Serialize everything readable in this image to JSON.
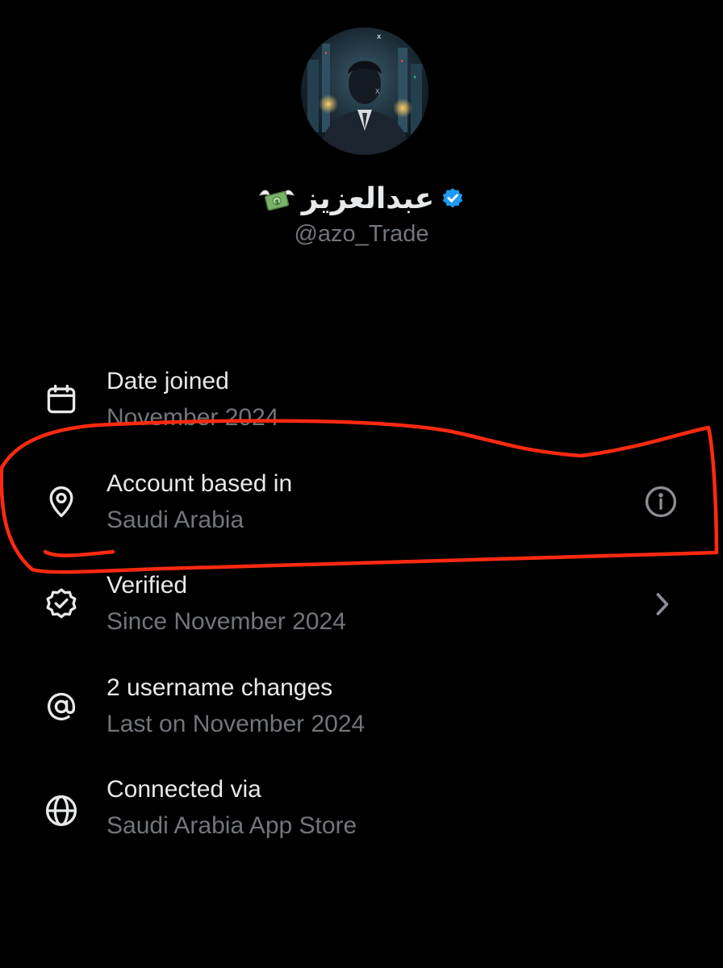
{
  "profile": {
    "display_name": "عبدالعزيز",
    "handle": "@azo_Trade",
    "icons": {
      "avatar": "profile-photo",
      "emoji": "money-with-wings-emoji",
      "badge": "verified-badge-icon"
    },
    "colors": {
      "badge": "#1d9bf0",
      "background": "#000000",
      "primary_text": "#e7e9ea",
      "secondary_text": "#71767b"
    }
  },
  "about": {
    "rows": [
      {
        "icon": "calendar-icon",
        "title": "Date joined",
        "value": "November 2024"
      },
      {
        "icon": "location-pin-icon",
        "title": "Account based in",
        "value": "Saudi Arabia",
        "trailing_icon": "info-icon"
      },
      {
        "icon": "verified-check-icon",
        "title": "Verified",
        "value": "Since November 2024",
        "trailing_icon": "chevron-right-icon"
      },
      {
        "icon": "at-sign-icon",
        "title": "2 username changes",
        "value": "Last on November 2024"
      },
      {
        "icon": "globe-icon",
        "title": "Connected via",
        "value": "Saudi Arabia App Store"
      }
    ]
  },
  "annotation": {
    "type": "hand-drawn-circle",
    "color": "#ff2a10"
  }
}
